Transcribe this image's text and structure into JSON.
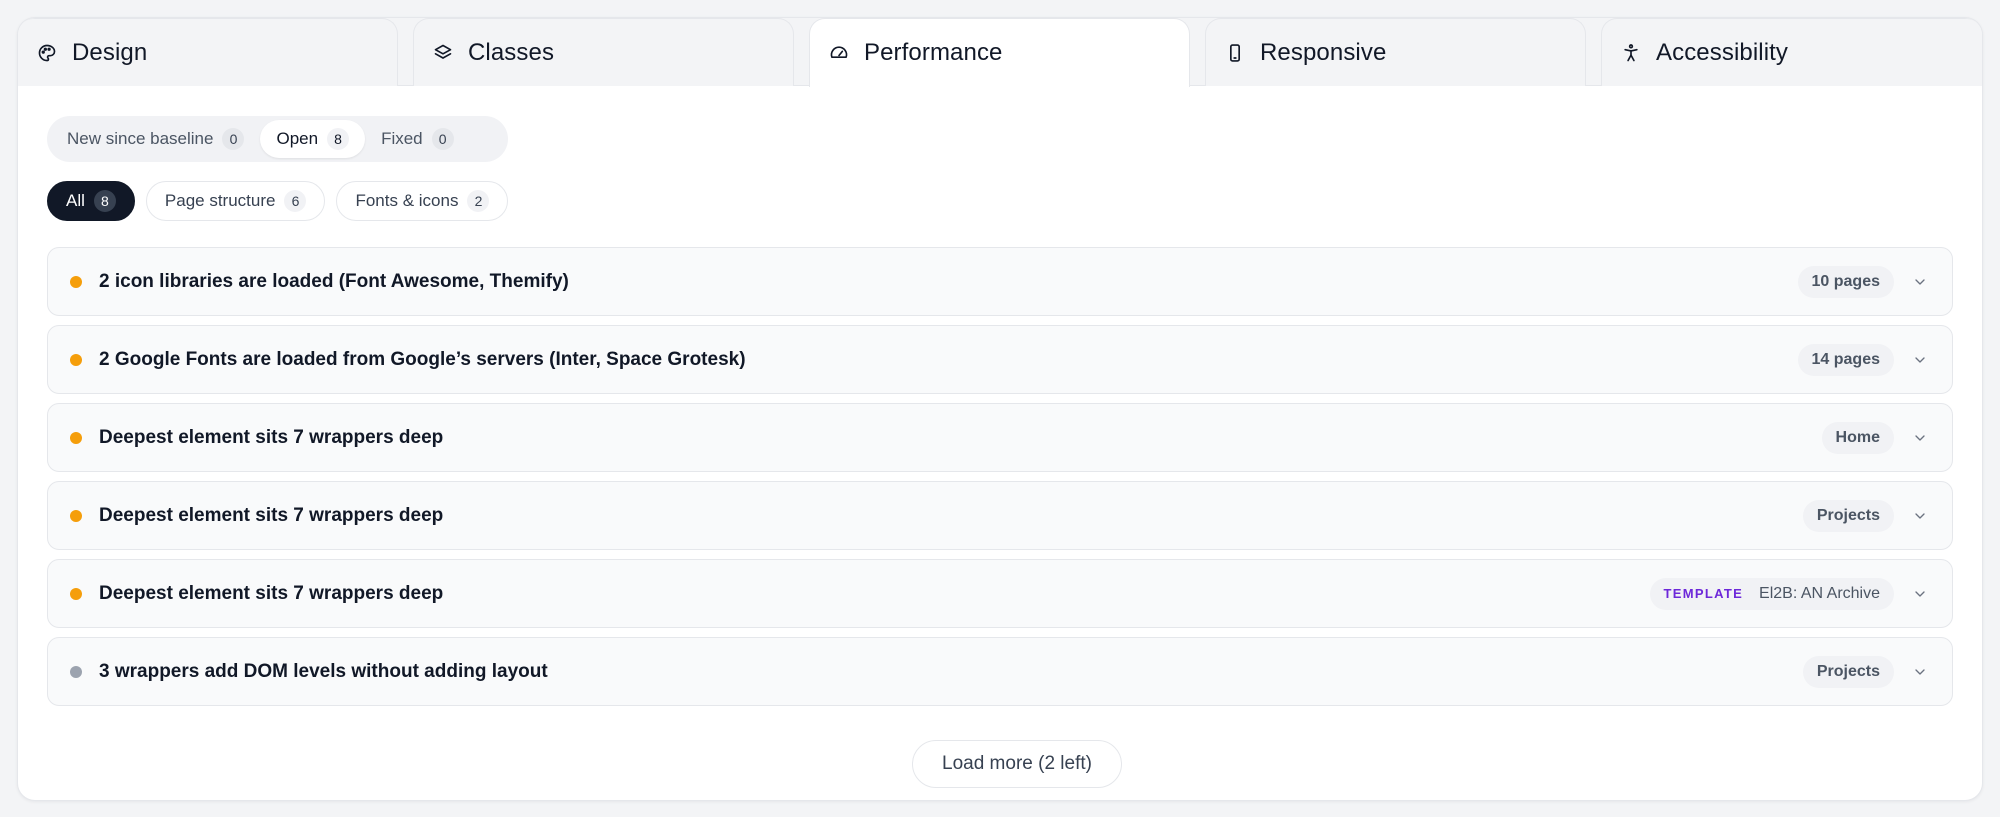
{
  "tabs": [
    {
      "label": "Design",
      "icon": "palette-icon",
      "active": false
    },
    {
      "label": "Classes",
      "icon": "layers-icon",
      "active": false
    },
    {
      "label": "Performance",
      "icon": "gauge-icon",
      "active": true
    },
    {
      "label": "Responsive",
      "icon": "smartphone-icon",
      "active": false
    },
    {
      "label": "Accessibility",
      "icon": "accessibility-icon",
      "active": false
    }
  ],
  "status_filter": [
    {
      "label": "New since baseline",
      "count": "0",
      "active": false
    },
    {
      "label": "Open",
      "count": "8",
      "active": true
    },
    {
      "label": "Fixed",
      "count": "0",
      "active": false
    }
  ],
  "category_filter": [
    {
      "label": "All",
      "count": "8",
      "active": true
    },
    {
      "label": "Page structure",
      "count": "6",
      "active": false
    },
    {
      "label": "Fonts & icons",
      "count": "2",
      "active": false
    }
  ],
  "issues": [
    {
      "title": "2 icon libraries are loaded (Font Awesome, Themify)",
      "scope": "10 pages",
      "severity": "warning"
    },
    {
      "title": "2 Google Fonts are loaded from Google’s servers (Inter, Space Grotesk)",
      "scope": "14 pages",
      "severity": "warning"
    },
    {
      "title": "Deepest element sits 7 wrappers deep",
      "scope": "Home",
      "severity": "warning"
    },
    {
      "title": "Deepest element sits 7 wrappers deep",
      "scope": "Projects",
      "severity": "warning"
    },
    {
      "title": "Deepest element sits 7 wrappers deep",
      "scope_tag": "TEMPLATE",
      "scope": "El2B: AN Archive",
      "severity": "warning"
    },
    {
      "title": "3 wrappers add DOM levels without adding layout",
      "scope": "Projects",
      "severity": "info"
    }
  ],
  "load_more_label": "Load more (2 left)",
  "colors": {
    "warning": "#f59e0b",
    "info": "#9ca3af",
    "accent_dark": "#111827",
    "template_tag": "#6d28d9"
  }
}
